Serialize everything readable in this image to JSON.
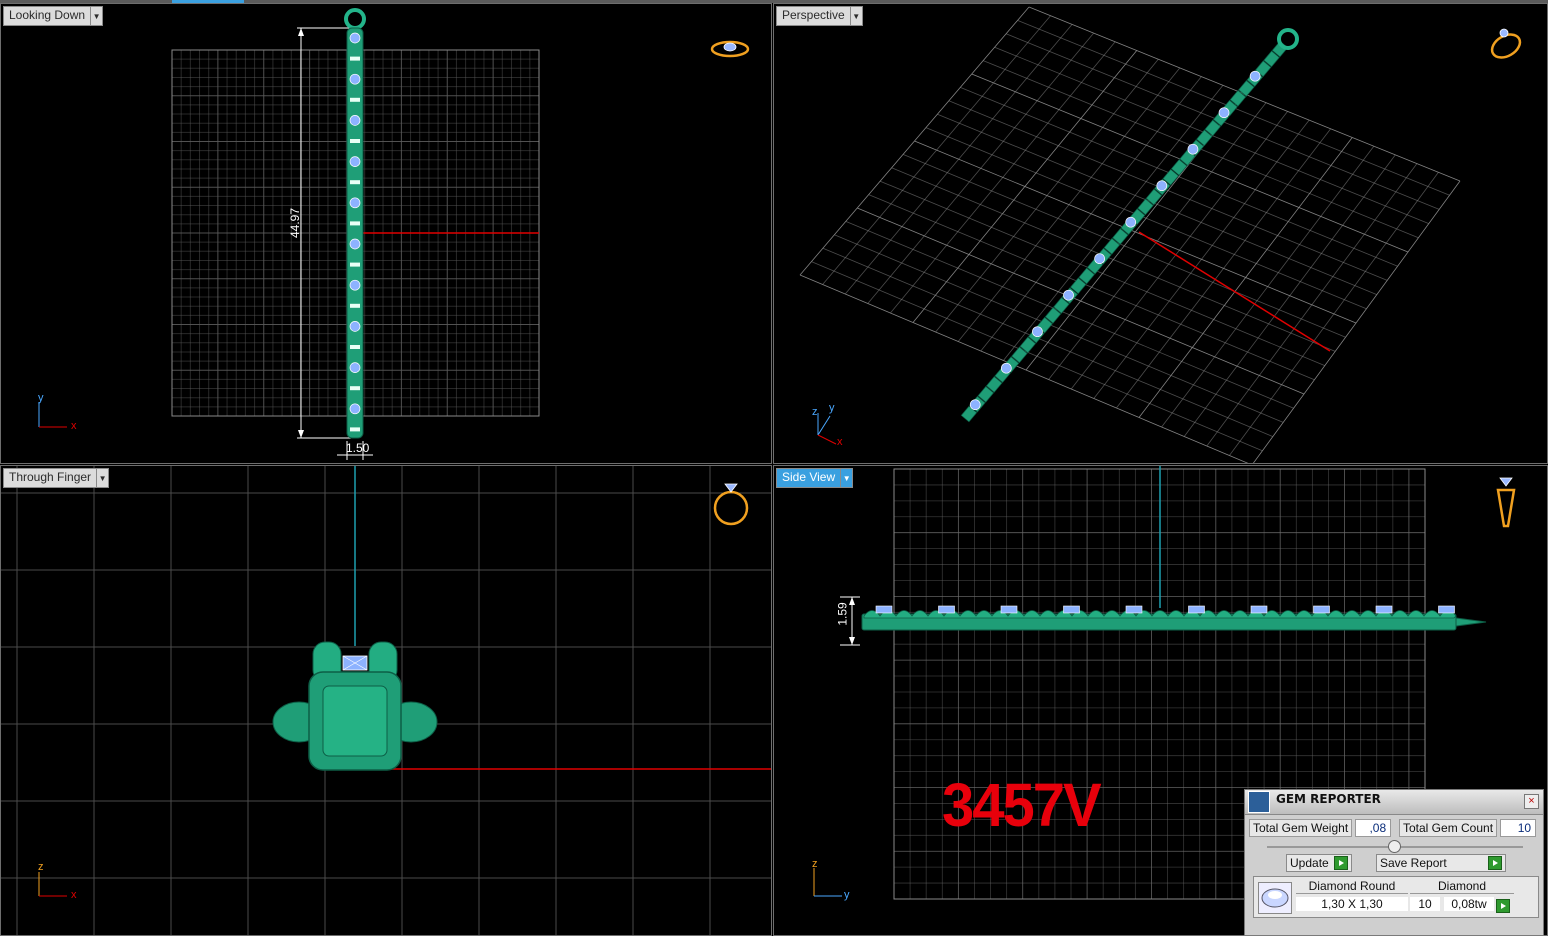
{
  "viewports": {
    "top_left": {
      "label": "Looking Down",
      "dim_length": "44.97",
      "dim_width": "1.50",
      "axis_v": "y",
      "axis_h": "x"
    },
    "top_right": {
      "label": "Perspective",
      "axis_v1": "z",
      "axis_v2": "y",
      "axis_h": "x"
    },
    "bottom_left": {
      "label": "Through Finger",
      "axis_v": "z",
      "axis_h": "x"
    },
    "bottom_right": {
      "label": "Side View",
      "dim_height": "1.59",
      "axis_v": "z",
      "axis_h": "y",
      "active": true
    }
  },
  "stamp_text": "3457V",
  "gem_reporter": {
    "title": "GEM REPORTER",
    "close_glyph": "×",
    "total_weight_label": "Total Gem Weight",
    "total_weight_value": ",08",
    "total_count_label": "Total Gem Count",
    "total_count_value": "10",
    "update_label": "Update",
    "save_report_label": "Save Report",
    "row": {
      "gem_name": "Diamond Round",
      "size": "1,30 X 1,30",
      "material": "Diamond",
      "count": "10",
      "weight": "0,08tw"
    }
  },
  "colors": {
    "accent": "#3aa0e0",
    "model": "#1f9e77",
    "gem": "#8db2ff",
    "axis_red": "#e00000",
    "axis_teal": "#1e9fb0",
    "stamp": "#e8000b"
  },
  "icons": [
    "ring-top-icon",
    "ring-perspective-icon",
    "ring-front-icon",
    "ring-side-icon",
    "dropdown-arrow-icon",
    "gem-reporter-icon",
    "close-icon",
    "play-icon",
    "diamond-thumbnail-icon"
  ]
}
